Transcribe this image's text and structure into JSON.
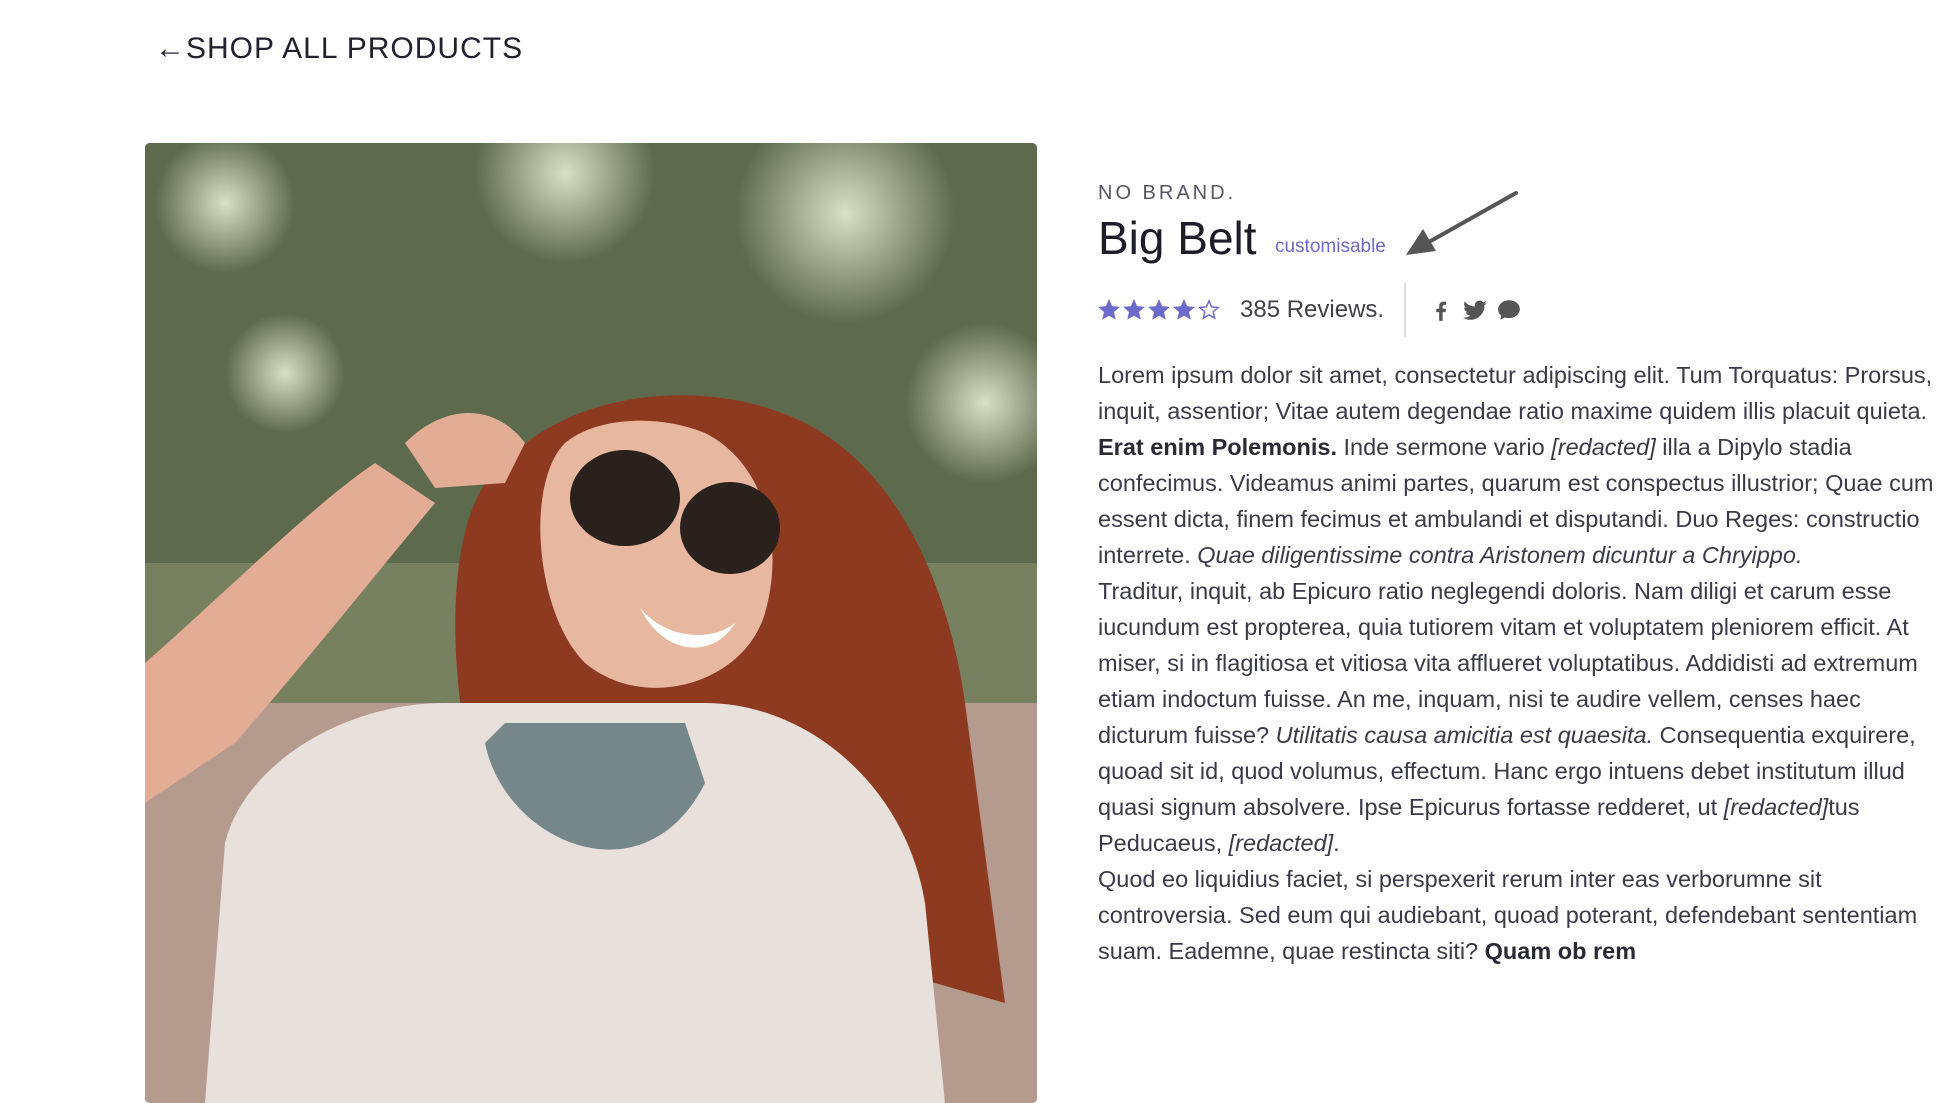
{
  "nav": {
    "back_label": "←SHOP ALL PRODUCTS"
  },
  "product": {
    "brand": "NO BRAND.",
    "title": "Big Belt",
    "tag": "customisable",
    "rating": 4,
    "rating_max": 5,
    "reviews_label": "385 Reviews.",
    "image_alt": "Smiling woman with red hair wearing sunglasses"
  },
  "social": [
    "facebook-icon",
    "twitter-icon",
    "comment-icon"
  ],
  "colors": {
    "accent": "#6c6bc9",
    "text": "#3a3a48"
  },
  "description": [
    [
      {
        "t": "Lorem ipsum dolor sit amet, consectetur adipiscing elit. Tum Torquatus: Prorsus, inquit, assentior; Vitae autem degendae ratio maxime quidem illis placuit quieta. ",
        "s": "n"
      },
      {
        "t": "Erat enim Polemonis.",
        "s": "b"
      },
      {
        "t": " Inde sermone vario ",
        "s": "n"
      },
      {
        "t": "[redacted]",
        "s": "i"
      },
      {
        "t": " illa a Dipylo stadia confecimus. Videamus animi partes, quarum est conspectus illustrior; Quae cum essent dicta, finem fecimus et ambulandi et disputandi. Duo Reges: constructio interrete. ",
        "s": "n"
      },
      {
        "t": "Quae diligentissime contra Aristonem dicuntur a Chryippo.",
        "s": "i"
      }
    ],
    [
      {
        "t": "Traditur, inquit, ab Epicuro ratio neglegendi doloris. Nam diligi et carum esse iucundum est propterea, quia tutiorem vitam et voluptatem pleniorem efficit. At miser, si in flagitiosa et vitiosa vita afflueret voluptatibus. Addidisti ad extremum etiam indoctum fuisse. An me, inquam, nisi te audire vellem, censes haec dicturum fuisse? ",
        "s": "n"
      },
      {
        "t": "Utilitatis causa amicitia est quaesita.",
        "s": "i"
      },
      {
        "t": " Consequentia exquirere, quoad sit id, quod volumus, effectum. Hanc ergo intuens debet institutum illud quasi signum absolvere. Ipse Epicurus fortasse redderet, ut ",
        "s": "n"
      },
      {
        "t": "[redacted]",
        "s": "i"
      },
      {
        "t": "tus Peducaeus, ",
        "s": "n"
      },
      {
        "t": "[redacted]",
        "s": "i"
      },
      {
        "t": ".",
        "s": "n"
      }
    ],
    [
      {
        "t": "Quod eo liquidius faciet, si perspexerit rerum inter eas verborumne sit controversia. Sed eum qui audiebant, quoad poterant, defendebant sententiam suam. Eademne, quae restincta siti? ",
        "s": "n"
      },
      {
        "t": "Quam ob rem",
        "s": "b"
      }
    ]
  ]
}
